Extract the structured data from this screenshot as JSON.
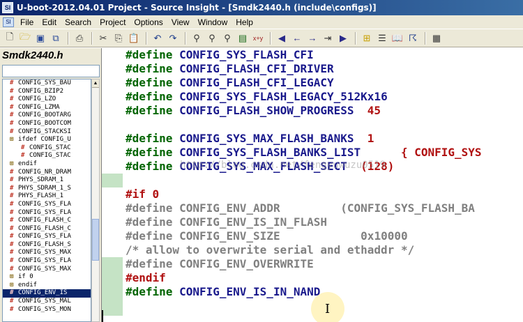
{
  "window": {
    "title": "U-boot-2012.04.01 Project - Source Insight - [Smdk2440.h (include\\configs)]",
    "app_icon": "SI"
  },
  "menu": {
    "items": [
      {
        "label": "File"
      },
      {
        "label": "Edit"
      },
      {
        "label": "Search"
      },
      {
        "label": "Project"
      },
      {
        "label": "Options"
      },
      {
        "label": "View"
      },
      {
        "label": "Window"
      },
      {
        "label": "Help"
      }
    ]
  },
  "toolbar": {
    "icons": [
      "new-file-icon",
      "open-folder-icon",
      "save-icon",
      "save-all-icon",
      "print-icon",
      "cut-icon",
      "copy-icon",
      "paste-icon",
      "undo-icon",
      "redo-icon",
      "search-icon",
      "search-project-icon",
      "replace-icon",
      "search-files-icon",
      "cross-reference-icon",
      "jump-back-icon",
      "jump-forward-icon",
      "jump-to-icon",
      "go-to-icon",
      "bookmark-icon",
      "browse-icon",
      "reference-icon",
      "book-icon",
      "relation-icon"
    ]
  },
  "symbol_panel": {
    "title": "Smdk2440.h",
    "search_value": "",
    "items": [
      {
        "label": "CONFIG_SYS_BAU",
        "icon": "hash-define-icon"
      },
      {
        "label": "CONFIG_BZIP2",
        "icon": "hash-define-icon"
      },
      {
        "label": "CONFIG_LZO",
        "icon": "hash-define-icon"
      },
      {
        "label": "CONFIG_LZMA",
        "icon": "hash-define-icon"
      },
      {
        "label": "CONFIG_BOOTARG",
        "icon": "hash-define-icon"
      },
      {
        "label": "CONFIG_BOOTCOM",
        "icon": "hash-define-icon"
      },
      {
        "label": "CONFIG_STACKSI",
        "icon": "hash-define-icon"
      },
      {
        "label": "ifdef CONFIG_U",
        "icon": "conditional-icon"
      },
      {
        "label": "CONFIG_STAC",
        "icon": "hash-define-icon",
        "indent": true
      },
      {
        "label": "CONFIG_STAC",
        "icon": "hash-define-icon",
        "indent": true
      },
      {
        "label": "endif",
        "icon": "conditional-icon"
      },
      {
        "label": "CONFIG_NR_DRAM",
        "icon": "hash-define-icon"
      },
      {
        "label": "PHYS_SDRAM_1",
        "icon": "hash-define-icon"
      },
      {
        "label": "PHYS_SDRAM_1_S",
        "icon": "hash-define-icon"
      },
      {
        "label": "PHYS_FLASH_1",
        "icon": "hash-define-icon"
      },
      {
        "label": "CONFIG_SYS_FLA",
        "icon": "hash-define-icon"
      },
      {
        "label": "CONFIG_SYS_FLA",
        "icon": "hash-define-icon"
      },
      {
        "label": "CONFIG_FLASH_C",
        "icon": "hash-define-icon"
      },
      {
        "label": "CONFIG_FLASH_C",
        "icon": "hash-define-icon"
      },
      {
        "label": "CONFIG_SYS_FLA",
        "icon": "hash-define-icon"
      },
      {
        "label": "CONFIG_FLASH_S",
        "icon": "hash-define-icon"
      },
      {
        "label": "CONFIG_SYS_MAX",
        "icon": "hash-define-icon"
      },
      {
        "label": "CONFIG_SYS_FLA",
        "icon": "hash-define-icon"
      },
      {
        "label": "CONFIG_SYS_MAX",
        "icon": "hash-define-icon"
      },
      {
        "label": "if 0",
        "icon": "conditional-icon"
      },
      {
        "label": "endif",
        "icon": "conditional-icon"
      },
      {
        "label": "CONFIG_ENV_IS",
        "icon": "hash-define-icon",
        "selected": true
      },
      {
        "label": "CONFIG_SYS_MAL",
        "icon": "hash-define-icon"
      },
      {
        "label": "CONFIG_SYS_MON",
        "icon": "hash-define-icon"
      }
    ]
  },
  "editor": {
    "lines": [
      {
        "directive": "#define",
        "name": "CONFIG_SYS_FLASH_CFI",
        "value": "",
        "style": "active"
      },
      {
        "directive": "#define",
        "name": "CONFIG_FLASH_CFI_DRIVER",
        "value": "",
        "style": "active"
      },
      {
        "directive": "#define",
        "name": "CONFIG_FLASH_CFI_LEGACY",
        "value": "",
        "style": "active"
      },
      {
        "directive": "#define",
        "name": "CONFIG_SYS_FLASH_LEGACY_512Kx16",
        "value": "",
        "style": "active"
      },
      {
        "directive": "#define",
        "name": "CONFIG_FLASH_SHOW_PROGRESS",
        "value": "45",
        "style": "active"
      },
      {
        "directive": "",
        "name": "",
        "value": "",
        "style": "blank"
      },
      {
        "directive": "#define",
        "name": "CONFIG_SYS_MAX_FLASH_BANKS",
        "value": "1",
        "style": "active"
      },
      {
        "directive": "#define",
        "name": "CONFIG_SYS_FLASH_BANKS_LIST",
        "value": "{ CONFIG_SYS",
        "style": "active"
      },
      {
        "directive": "#define",
        "name": "CONFIG_SYS_MAX_FLASH_SECT",
        "value": "(128)",
        "style": "active"
      },
      {
        "directive": "",
        "name": "",
        "value": "",
        "style": "blank"
      },
      {
        "directive": "#if 0",
        "name": "",
        "value": "",
        "style": "directive"
      },
      {
        "directive": "#define",
        "name": "CONFIG_ENV_ADDR",
        "value": "(CONFIG_SYS_FLASH_BA",
        "style": "inactive"
      },
      {
        "directive": "#define",
        "name": "CONFIG_ENV_IS_IN_FLASH",
        "value": "",
        "style": "inactive"
      },
      {
        "directive": "#define",
        "name": "CONFIG_ENV_SIZE",
        "value": "0x10000",
        "style": "inactive"
      },
      {
        "directive": "/* allow to overwrite serial and ethaddr */",
        "name": "",
        "value": "",
        "style": "comment"
      },
      {
        "directive": "#define",
        "name": "CONFIG_ENV_OVERWRITE",
        "value": "",
        "style": "inactive"
      },
      {
        "directive": "#endif",
        "name": "",
        "value": "",
        "style": "directive"
      },
      {
        "directive": "#define",
        "name": "CONFIG_ENV_IS_IN_NAND",
        "value": "",
        "style": "active"
      }
    ],
    "watermark": "http://blog.csdn.net/fengyuwuzu0519",
    "colors": {
      "directive": "#006400",
      "macro": "#1a1a8c",
      "number": "#b01010",
      "inactive": "#808080",
      "gutter_mark": "#c5e3c5"
    }
  }
}
